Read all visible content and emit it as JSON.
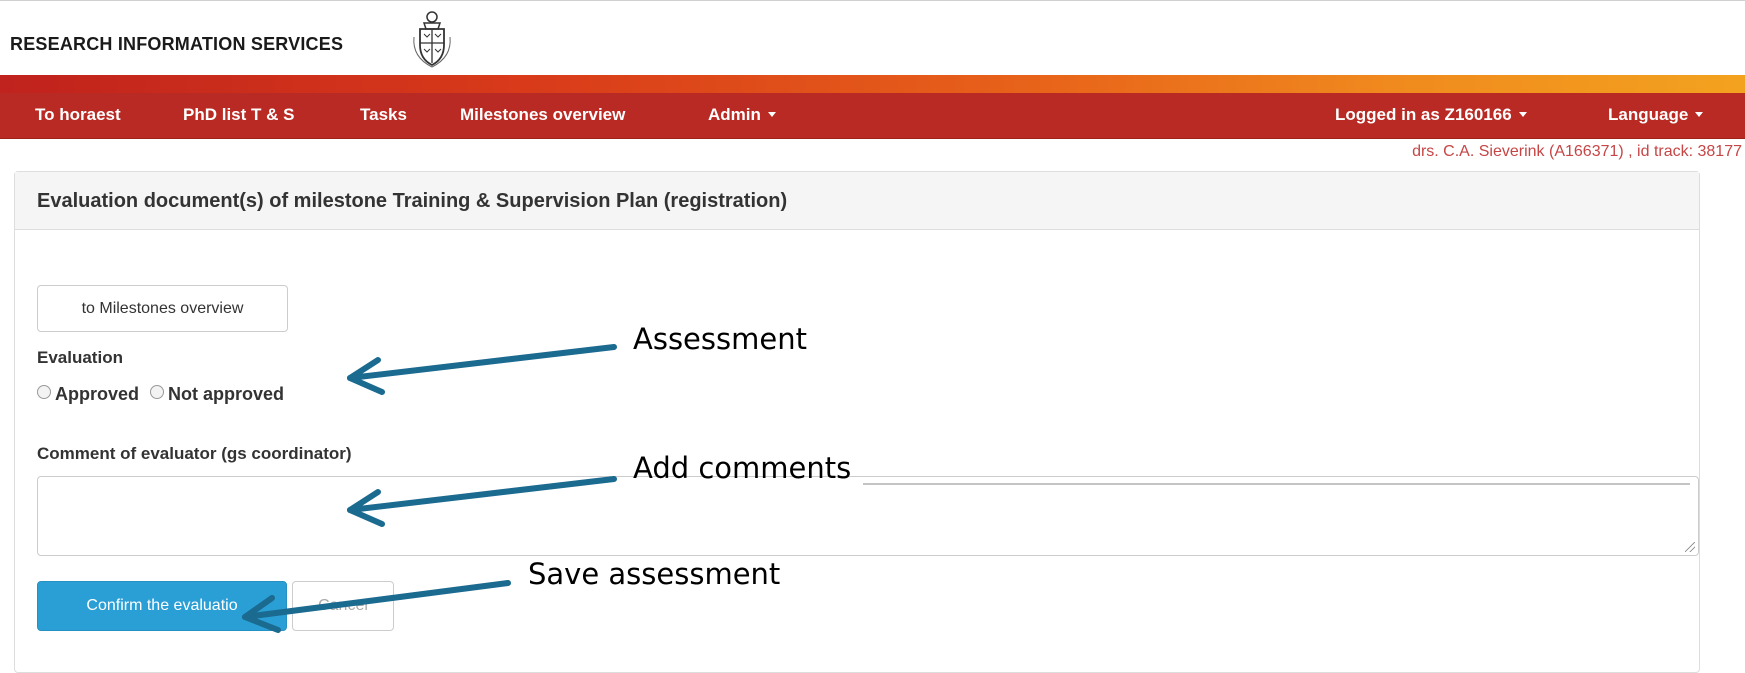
{
  "header": {
    "brand": "RESEARCH INFORMATION SERVICES",
    "crest_icon": "university-crest-icon"
  },
  "navbar": {
    "items": [
      {
        "label": "To horaest"
      },
      {
        "label": "PhD list T & S"
      },
      {
        "label": "Tasks"
      },
      {
        "label": "Milestones overview"
      },
      {
        "label": "Admin",
        "dropdown": true
      }
    ],
    "right_items": [
      {
        "label": "Logged in as Z160166",
        "dropdown": true
      },
      {
        "label": "Language",
        "dropdown": true
      }
    ],
    "user_info": "drs. C.A. Sieverink (A166371) , id track: 38177"
  },
  "panel": {
    "title": "Evaluation document(s) of milestone Training & Supervision Plan (registration)",
    "back_button": "to Milestones overview",
    "evaluation_label": "Evaluation",
    "radio_options": [
      "Approved",
      "Not approved"
    ],
    "comment_label": "Comment of evaluator (gs coordinator)",
    "comment_value": "",
    "confirm_button": "Confirm the evaluatio",
    "cancel_button": "Cancel"
  },
  "annotations": {
    "assessment": "Assessment",
    "add_comments": "Add comments",
    "save_assessment": "Save assessment"
  },
  "colors": {
    "navbar": "#b82a23",
    "primary_button": "#2a9fd6",
    "annotation_arrow": "#1b6a8f",
    "user_info": "#c64545"
  }
}
